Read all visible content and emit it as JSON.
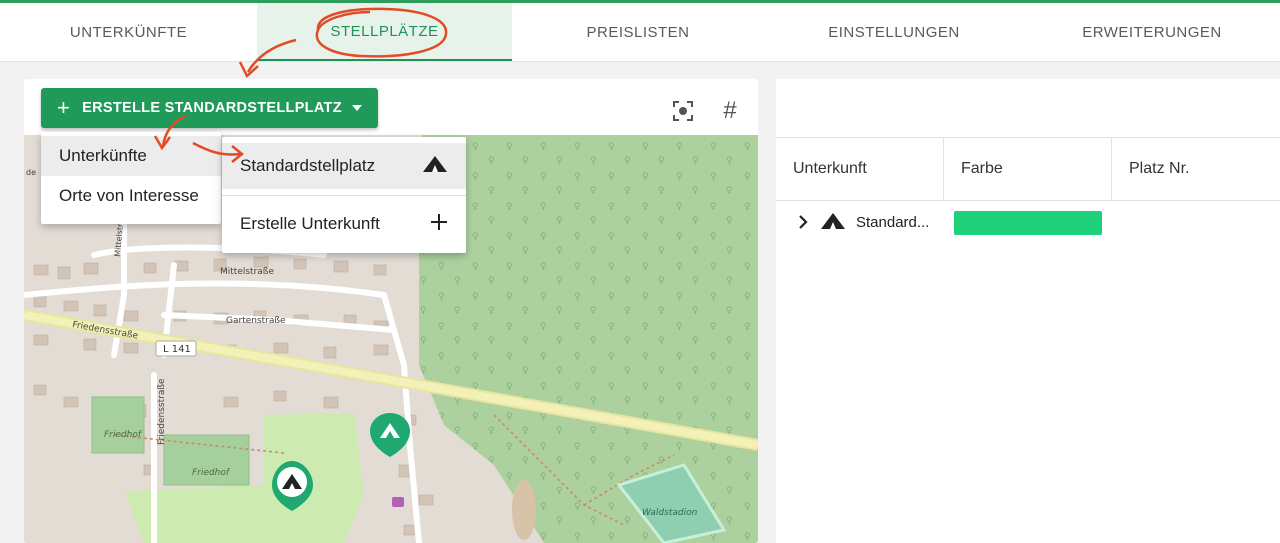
{
  "nav": {
    "tabs": [
      {
        "label": "UNTERKÜNFTE"
      },
      {
        "label": "STELLPLÄTZE"
      },
      {
        "label": "PREISLISTEN"
      },
      {
        "label": "EINSTELLUNGEN"
      },
      {
        "label": "ERWEITERUNGEN"
      }
    ],
    "active_index": 1
  },
  "toolbar": {
    "create_button_label": "ERSTELLE STANDARDSTELLPLATZ",
    "plus_glyph": "+",
    "focus_icon": "focus-frame-icon",
    "grid_icon": "hash-icon",
    "grid_glyph": "#"
  },
  "menu": {
    "items": [
      {
        "label": "Unterkünfte"
      },
      {
        "label": "Orte von Interesse"
      }
    ],
    "submenu": [
      {
        "label": "Standardstellplatz",
        "icon": "tent-icon"
      },
      {
        "label": "Erstelle Unterkunft",
        "icon": "plus-icon"
      }
    ]
  },
  "map": {
    "labels": {
      "mittelstrasse": "Mittelstraße",
      "gartenstrasse": "Gartenstraße",
      "friedensstrasse": "Friedensstraße",
      "friedensstrasse_vertical": "Friedensstraße",
      "l141": "L 141",
      "friedhof1": "Friedhof",
      "friedhof2": "Friedhof",
      "waldstadion": "Waldstadion",
      "mittelstr_partial": "Mittelstr",
      "de": "de"
    },
    "markers": [
      {
        "icon": "tent-icon",
        "color": "#1fa971"
      },
      {
        "icon": "tent-icon",
        "color": "#1fa971"
      }
    ]
  },
  "table": {
    "columns": [
      "Unterkunft",
      "Farbe",
      "Platz Nr."
    ],
    "rows": [
      {
        "name": "Standard...",
        "color": "#1fd07a",
        "platz": ""
      }
    ]
  },
  "colors": {
    "accent": "#1f9a59",
    "annotation": "#e24b26"
  }
}
